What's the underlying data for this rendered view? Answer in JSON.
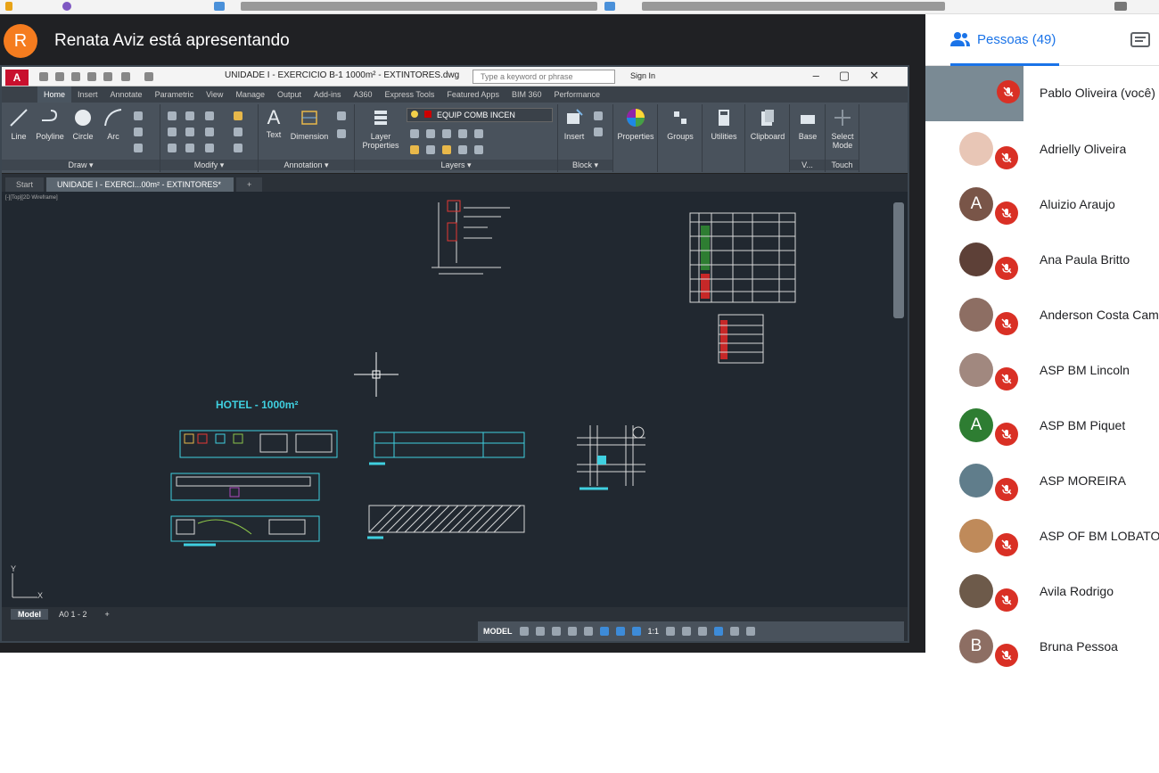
{
  "meet": {
    "presenter_initial": "R",
    "presenter_text": "Renata Aviz está apresentando",
    "people_tab_label": "Pessoas (49)",
    "participants": [
      {
        "name": "Pablo Oliveira (você)",
        "avatar_initial": "",
        "avatar_color": "#7a8a94",
        "muted": true
      },
      {
        "name": "Adrielly Oliveira",
        "avatar_initial": "",
        "avatar_color": "#e8c6b6",
        "muted": true
      },
      {
        "name": "Aluizio Araujo",
        "avatar_initial": "A",
        "avatar_color": "#795548",
        "muted": true
      },
      {
        "name": "Ana Paula Britto",
        "avatar_initial": "",
        "avatar_color": "#5d4037",
        "muted": true
      },
      {
        "name": "Anderson Costa Cam",
        "avatar_initial": "",
        "avatar_color": "#8d6e63",
        "muted": true
      },
      {
        "name": "ASP BM Lincoln",
        "avatar_initial": "",
        "avatar_color": "#a1887f",
        "muted": true
      },
      {
        "name": "ASP BM Piquet",
        "avatar_initial": "A",
        "avatar_color": "#2e7d32",
        "muted": true
      },
      {
        "name": "ASP MOREIRA",
        "avatar_initial": "",
        "avatar_color": "#607d8b",
        "muted": true
      },
      {
        "name": "ASP OF BM LOBATO",
        "avatar_initial": "",
        "avatar_color": "#bf8a5a",
        "muted": true
      },
      {
        "name": "Avila Rodrigo",
        "avatar_initial": "",
        "avatar_color": "#6d5a4a",
        "muted": true
      },
      {
        "name": "Bruna Pessoa",
        "avatar_initial": "B",
        "avatar_color": "#8d6e63",
        "muted": true
      }
    ]
  },
  "autocad": {
    "logo": "A",
    "doc_title": "UNIDADE I - EXERCICIO B-1 1000m² - EXTINTORES.dwg",
    "search_placeholder": "Type a keyword or phrase",
    "sign_in": "Sign In",
    "tabs": [
      "Home",
      "Insert",
      "Annotate",
      "Parametric",
      "View",
      "Manage",
      "Output",
      "Add-ins",
      "A360",
      "Express Tools",
      "Featured Apps",
      "BIM 360",
      "Performance"
    ],
    "draw_tools": [
      "Line",
      "Polyline",
      "Circle",
      "Arc"
    ],
    "group_labels": {
      "draw": "Draw ▾",
      "modify": "Modify ▾",
      "annotation": "Annotation ▾",
      "layers": "Layers ▾",
      "block": "Block ▾"
    },
    "annotation_tools": [
      "Text",
      "Dimension"
    ],
    "layer_props": "Layer Properties",
    "layer_name": "EQUIP COMB INCEN",
    "insert": "Insert",
    "properties": "Properties",
    "groups": "Groups",
    "utilities": "Utilities",
    "clipboard": "Clipboard",
    "base": "Base",
    "select_mode": "Select Mode",
    "touch": "Touch",
    "v_label": "V...",
    "doc_tabs": [
      "Start",
      "UNIDADE I - EXERCI...00m² - EXTINTORES*"
    ],
    "viewport_label": "[-][Top][2D Wireframe]",
    "drawing_title": "HOTEL - 1000m²",
    "layout_tabs": [
      "Model",
      "A0 1 - 2"
    ],
    "status_model": "MODEL",
    "scale": "1:1"
  },
  "colors": {
    "accent": "#1a73e8",
    "muted_red": "#d93025",
    "cad_cyan": "#3fd0e0",
    "cad_bg": "#212830"
  }
}
